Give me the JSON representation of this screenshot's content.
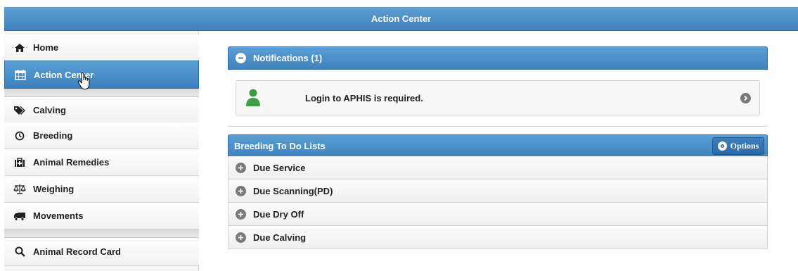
{
  "header": {
    "title": "Action Center"
  },
  "sidebar": {
    "items": [
      {
        "label": "Home",
        "icon": "home-icon"
      },
      {
        "label": "Action Center",
        "icon": "calendar-icon",
        "active": true
      },
      {
        "label": "Calving",
        "icon": "tags-icon"
      },
      {
        "label": "Breeding",
        "icon": "clock-icon"
      },
      {
        "label": "Animal Remedies",
        "icon": "medkit-icon"
      },
      {
        "label": "Weighing",
        "icon": "scale-icon"
      },
      {
        "label": "Movements",
        "icon": "truck-icon"
      },
      {
        "label": "Animal Record Card",
        "icon": "search-icon"
      }
    ]
  },
  "notifications": {
    "title": "Notifications (1)",
    "message": "Login to APHIS is required."
  },
  "breeding": {
    "title": "Breeding To Do Lists",
    "options_label": "Options",
    "rows": [
      {
        "label": "Due Service"
      },
      {
        "label": "Due Scanning(PD)"
      },
      {
        "label": "Due Dry Off"
      },
      {
        "label": "Due Calving"
      }
    ]
  },
  "colors": {
    "accent": "#3f82bd",
    "person_icon": "#3aa043"
  }
}
